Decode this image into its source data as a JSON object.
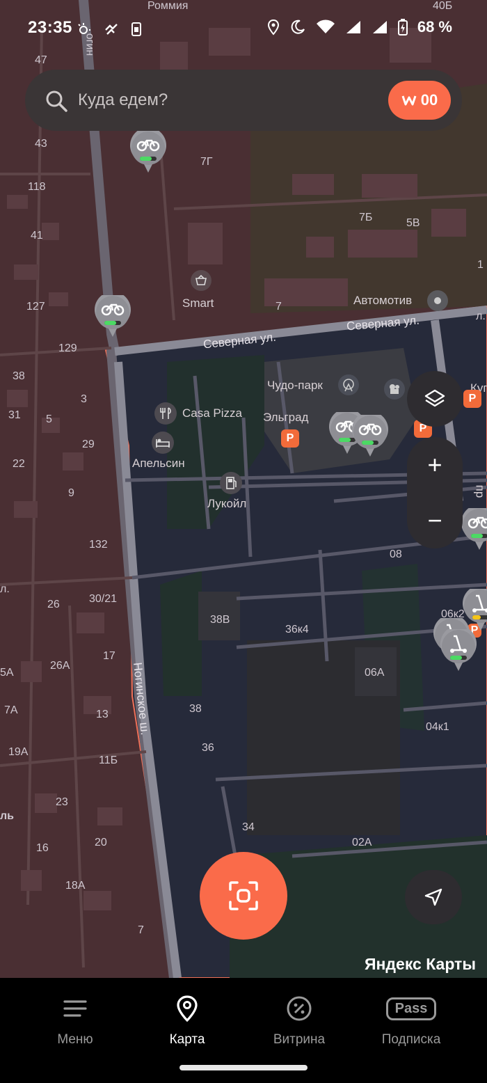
{
  "status_bar": {
    "time": "23:35",
    "battery_text": "68 %"
  },
  "search": {
    "placeholder": "Куда едем?",
    "wallet_label": "00"
  },
  "map_labels": {
    "street_severnaya_1": "Северная ул.",
    "street_severnaya_2": "Северная ул.",
    "street_noginskoe": "Ногинское ш.",
    "street_top": "огин",
    "poi_smart": "Smart",
    "poi_avtomotiv": "Автомотив",
    "poi_chudo_park": "Чудо-парк",
    "poi_eldgrad": "Эльград",
    "poi_casa_pizza": "Casa Pizza",
    "poi_apelsin": "Апельсин",
    "poi_lukoil": "Лукойл",
    "poi_rommiya": "Роммия",
    "edge_kup": "Куп",
    "edge_pro": "пр",
    "edge_l": "л.",
    "edge_l_left": "ль",
    "numbers": {
      "n40b": "40Б",
      "n47": "47",
      "n43": "43",
      "n118": "118",
      "n41": "41",
      "n127": "127",
      "n129": "129",
      "n38a": "38",
      "n3": "3",
      "n31": "31",
      "n5": "5",
      "n29": "29",
      "n22": "22",
      "n9": "9",
      "n132": "132",
      "n26": "26",
      "n30_21": "30/21",
      "n5a": "5А",
      "n26a": "26А",
      "n17": "17",
      "n7a": "7А",
      "n13": "13",
      "n19a": "19А",
      "n11b": "11Б",
      "n23": "23",
      "n16": "16",
      "n20": "20",
      "n18a": "18А",
      "n7g": "7Г",
      "n7b": "7Б",
      "n5v": "5В",
      "n7": "7",
      "n08": "08",
      "n38v": "38В",
      "n36k4": "36к4",
      "n06a": "06А",
      "n06k2": "06к2",
      "n04k1": "04к1",
      "n38": "38",
      "n36": "36",
      "n34": "34",
      "n02a": "02А",
      "n7b2": "7",
      "n2": "7",
      "n1": "1"
    }
  },
  "controls": {
    "zoom_in": "+",
    "zoom_out": "−"
  },
  "brand": "Яндекс Карты",
  "bottom_nav": {
    "items": [
      {
        "label": "Меню",
        "icon": "menu-icon"
      },
      {
        "label": "Карта",
        "icon": "map-pin-icon"
      },
      {
        "label": "Витрина",
        "icon": "discount-icon"
      },
      {
        "label": "Подписка",
        "icon": "pass-icon"
      }
    ],
    "pass_badge": "Pass",
    "active": "Карта"
  },
  "colors": {
    "accent": "#fa6b4a",
    "zone_outside": "#4a2f33",
    "zone_inside": "#262a3a"
  }
}
